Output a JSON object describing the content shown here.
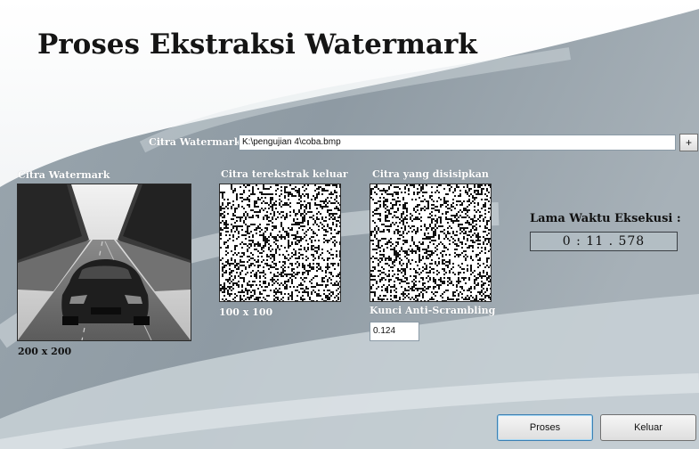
{
  "title": "Proses Ekstraksi Watermark",
  "watermark_path": {
    "label": "Citra Watermark",
    "value": "K:\\pengujian 4\\coba.bmp",
    "browse_label": "+"
  },
  "host_image": {
    "label": "Citra Watermark",
    "size": "200 x 200"
  },
  "extracted": {
    "label": "Citra terekstrak keluar",
    "size": "100 x 100"
  },
  "embedded": {
    "label": "Citra yang disisipkan"
  },
  "key": {
    "label": "Kunci Anti-Scrambling",
    "value": "0.124"
  },
  "execution": {
    "label": "Lama Waktu Eksekusi  :",
    "time": "0 : 11 . 578"
  },
  "buttons": {
    "process": "Proses",
    "exit": "Keluar"
  }
}
